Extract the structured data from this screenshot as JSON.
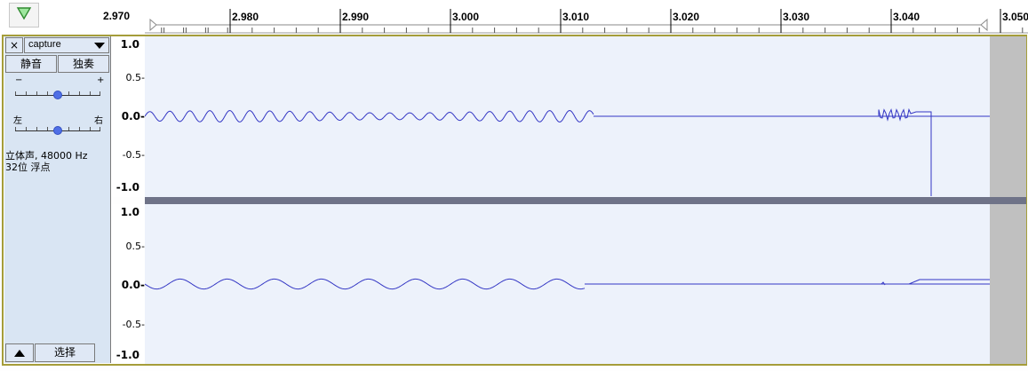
{
  "ruler": {
    "ticks": [
      "2.970",
      "2.980",
      "2.990",
      "3.000",
      "3.010",
      "3.020",
      "3.030",
      "3.040",
      "3.050"
    ]
  },
  "track": {
    "name": "capture",
    "close_label": "×",
    "mute_label": "静音",
    "solo_label": "独奏",
    "gain_minus": "−",
    "gain_plus": "+",
    "pan_left": "左",
    "pan_right": "右",
    "gain_value": 0.5,
    "pan_value": 0.5,
    "info_line1": "立体声, 48000 Hz",
    "info_line2": "32位 浮点",
    "select_label": "选择"
  },
  "channels": [
    {
      "scale": [
        "1.0",
        "0.5-",
        "0.0-",
        "-0.5-",
        "-1.0"
      ]
    },
    {
      "scale": [
        "1.0",
        "0.5-",
        "0.0-",
        "-0.5-",
        "-1.0"
      ]
    }
  ],
  "colors": {
    "panel": "#d9e5f3",
    "wave_bg": "#edf2fb",
    "waveform": "#3336c4",
    "selected_border": "#a59d3a",
    "separator": "#6f7388",
    "out_of_range": "#c0c0c0"
  },
  "icons": {
    "play": "play-triangle-icon",
    "close": "close-icon",
    "menu": "chevron-down-icon",
    "collapse": "collapse-up-icon"
  }
}
